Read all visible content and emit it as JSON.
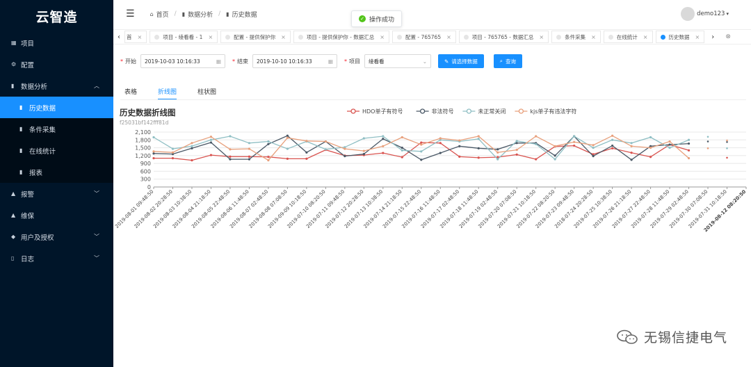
{
  "sidebar": {
    "logo": "云智造",
    "items": [
      {
        "label": "项目",
        "icon": "grid-icon"
      },
      {
        "label": "配置",
        "icon": "gear-icon"
      },
      {
        "label": "数据分析",
        "icon": "bar-chart-icon"
      }
    ],
    "sub_items": [
      {
        "label": "历史数据"
      },
      {
        "label": "条件采集"
      },
      {
        "label": "在线统计"
      },
      {
        "label": "报表"
      }
    ],
    "items_after": [
      {
        "label": "报警",
        "icon": "bell-icon"
      },
      {
        "label": "维保",
        "icon": "bell-icon"
      },
      {
        "label": "用户及授权",
        "icon": "layers-icon"
      },
      {
        "label": "日志",
        "icon": "book-icon"
      }
    ]
  },
  "header": {
    "breadcrumb": [
      "首页",
      "数据分析",
      "历史数据"
    ],
    "toast": "操作成功",
    "user": "demo123"
  },
  "tabs": [
    {
      "label": "首"
    },
    {
      "label": "项目 - 绫看看 - 1"
    },
    {
      "label": "配置 - 提供保护你"
    },
    {
      "label": "项目 - 提供保护你 - 数据汇总"
    },
    {
      "label": "配置 - 765765"
    },
    {
      "label": "项目 - 765765 - 数据汇总"
    },
    {
      "label": "条件采集"
    },
    {
      "label": "在线统计"
    },
    {
      "label": "历史数据"
    }
  ],
  "filters": {
    "start_label": "开始",
    "start_value": "2019-10-03 10:16:33",
    "end_label": "结束",
    "end_value": "2019-10-10 10:16:33",
    "project_label": "项目",
    "project_value": "绫看看",
    "select_button": "请选择数据",
    "query_button": "查询"
  },
  "view_tabs": [
    "表格",
    "折线图",
    "柱状图"
  ],
  "chart_title": "历史数据折线图",
  "chart_subtitle": "f25031bf142fff81d",
  "watermark": "无锡信捷电气",
  "colors": {
    "accent": "#1890ff",
    "sidebar": "#001529",
    "series": [
      "#d9534f",
      "#4a5866",
      "#8fbfc4",
      "#e8a07c"
    ]
  },
  "chart_data": {
    "type": "line",
    "legend_position": "top-right",
    "ylim": [
      0,
      2100
    ],
    "yticks": [
      "2,100",
      "1,800",
      "1,500",
      "1,200",
      "900",
      "600",
      "300",
      "0"
    ],
    "x": [
      "2019-08-01 09:48:50",
      "2019-08-02 20:28:50",
      "2019-08-03 10:38:50",
      "2019-08-04 21:18:50",
      "2019-08-05 22:48:50",
      "2019-08-06 11:48:50",
      "2019-08-07 02:48:50",
      "2019-08-08 07:08:50",
      "2019-09-09 10:18:50",
      "2019-07-10 08:20:50",
      "2019-07-11 09:48:50",
      "2019-07-12 20:28:50",
      "2019-07-13 10:38:50",
      "2019-07-14 21:18:50",
      "2019-07-15 22:48:50",
      "2019-07-16 11:48:50",
      "2019-07-17 02:48:50",
      "2019-07-18 11:48:50",
      "2019-07-19 02:48:50",
      "2019-07-20 07:08:50",
      "2019-07-21 10:18:50",
      "2019-07-22 08:20:50",
      "2019-07-23 09:48:50",
      "2018-07-24 20:28:50",
      "2019-07-25 10:38:50",
      "2019-07-26 21:18:50",
      "2019-07-27 22:48:50",
      "2019-07-28 11:48:50",
      "2019-07-29 02:48:50",
      "2019-07-30 07:08:50",
      "2019-07-31 10:18:50",
      "2019-08-12 08:20:50"
    ],
    "series": [
      {
        "name": "HDO单子有符号",
        "values": [
          1100,
          1100,
          1020,
          1220,
          1160,
          1160,
          1150,
          1080,
          1080,
          1420,
          1200,
          1220,
          1300,
          1140,
          1700,
          1680,
          1160,
          1120,
          1140,
          1240,
          1060,
          1550,
          1580,
          1250,
          1480,
          1310,
          1150,
          1620,
          1400,
          null,
          1120,
          null
        ]
      },
      {
        "name": "非法符号",
        "values": [
          1280,
          1260,
          1480,
          1700,
          1060,
          1060,
          1640,
          1960,
          1320,
          1740,
          1180,
          1260,
          1840,
          1500,
          1040,
          1300,
          1560,
          1480,
          1440,
          1680,
          1680,
          1200,
          1940,
          1180,
          1580,
          1040,
          1560,
          1620,
          1660,
          1740,
          1720,
          null
        ]
      },
      {
        "name": "未正常关闭",
        "values": [
          1900,
          1460,
          1560,
          1800,
          1940,
          1680,
          1740,
          1460,
          1740,
          1440,
          1520,
          1860,
          1940,
          1400,
          1360,
          1800,
          1740,
          1840,
          1060,
          1760,
          1640,
          1060,
          1940,
          1500,
          1800,
          1680,
          1900,
          1500,
          1800,
          1920,
          1480,
          null
        ]
      },
      {
        "name": "kjs单子有违法字符",
        "values": [
          1360,
          1320,
          1680,
          1920,
          1440,
          1460,
          1020,
          1880,
          1760,
          1740,
          1460,
          1380,
          1560,
          1900,
          1620,
          1860,
          1780,
          1940,
          1320,
          1420,
          1940,
          1560,
          1720,
          1600,
          1960,
          1560,
          1500,
          1740,
          1100,
          1480,
          1780,
          null
        ]
      }
    ]
  }
}
